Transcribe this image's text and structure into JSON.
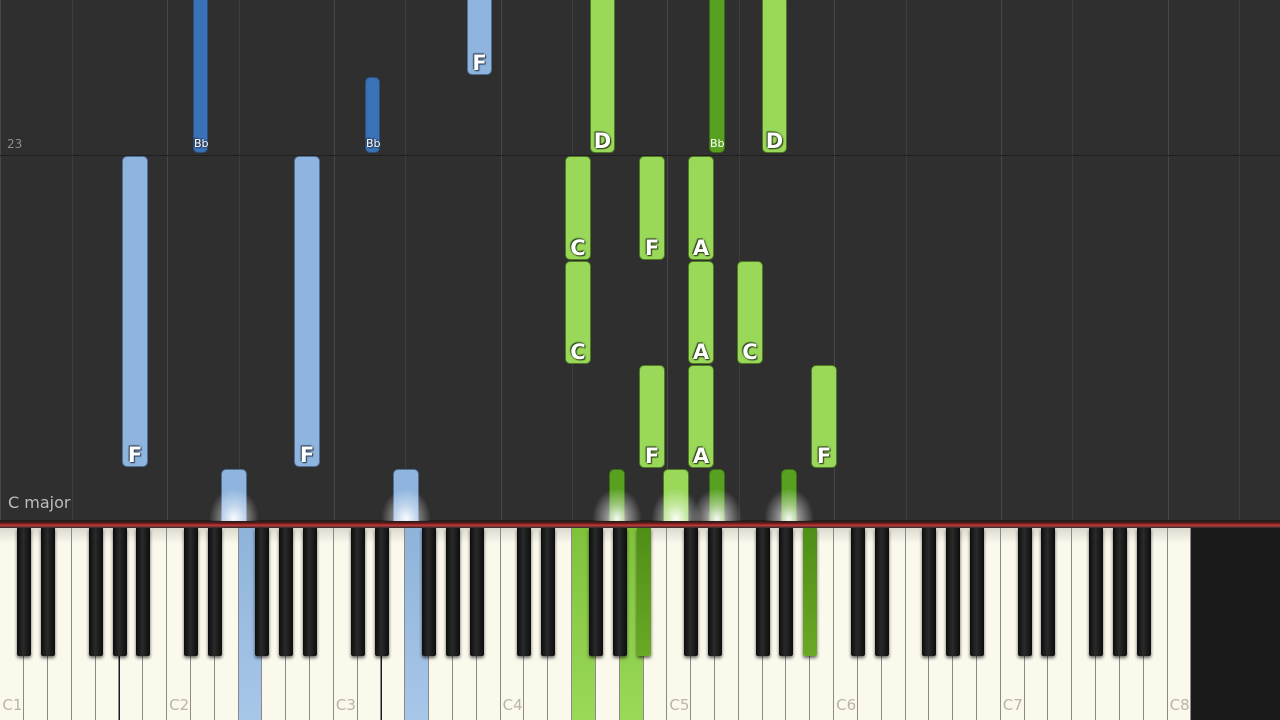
{
  "overlay": {
    "measure_number": "23",
    "key_signature": "C major"
  },
  "colors": {
    "left_hand_white": "#8fb4de",
    "left_hand_black": "#3a72b8",
    "right_hand_white": "#9ad85a",
    "right_hand_black": "#57a020",
    "note_outline": "#2d2d2d",
    "background": "#2f2f2f",
    "now_line": "#c83a3a"
  },
  "keyboard": {
    "octave_labels": [
      "C1",
      "C2",
      "C3",
      "C4",
      "C5",
      "C6",
      "C7",
      "C8"
    ],
    "pressed_keys": [
      {
        "key": "F2",
        "hand": "left"
      },
      {
        "key": "F3",
        "hand": "left"
      },
      {
        "key": "Bb4",
        "hand": "right"
      },
      {
        "key": "F4",
        "hand": "right"
      },
      {
        "key": "A4",
        "hand": "right"
      },
      {
        "key": "Bb5",
        "hand": "right"
      }
    ]
  },
  "notes": [
    {
      "label": "Bb",
      "hand": "left",
      "pitch": "Bb1"
    },
    {
      "label": "Bb",
      "hand": "left",
      "pitch": "Bb2"
    },
    {
      "label": "F",
      "hand": "left",
      "pitch": "F3"
    },
    {
      "label": "D",
      "hand": "right",
      "pitch": "D4"
    },
    {
      "label": "Bb",
      "hand": "right",
      "pitch": "Bb4"
    },
    {
      "label": "D",
      "hand": "right",
      "pitch": "D5"
    },
    {
      "label": "F",
      "hand": "left",
      "pitch": "F1"
    },
    {
      "label": "F",
      "hand": "left",
      "pitch": "F2"
    },
    {
      "label": "C",
      "hand": "right",
      "pitch": "C4"
    },
    {
      "label": "F",
      "hand": "right",
      "pitch": "F4"
    },
    {
      "label": "A",
      "hand": "right",
      "pitch": "A4"
    },
    {
      "label": "C",
      "hand": "right",
      "pitch": "C4"
    },
    {
      "label": "A",
      "hand": "right",
      "pitch": "A4"
    },
    {
      "label": "C",
      "hand": "right",
      "pitch": "C5"
    },
    {
      "label": "F",
      "hand": "right",
      "pitch": "F4"
    },
    {
      "label": "A",
      "hand": "right",
      "pitch": "A4"
    },
    {
      "label": "F",
      "hand": "right",
      "pitch": "F5"
    },
    {
      "label": "",
      "hand": "left",
      "pitch": "F2"
    },
    {
      "label": "",
      "hand": "left",
      "pitch": "F3"
    },
    {
      "label": "",
      "hand": "right",
      "pitch": "Bb4"
    },
    {
      "label": "",
      "hand": "right",
      "pitch": "A4"
    },
    {
      "label": "",
      "hand": "right",
      "pitch": "Bb4"
    },
    {
      "label": "",
      "hand": "right",
      "pitch": "Bb5"
    }
  ]
}
